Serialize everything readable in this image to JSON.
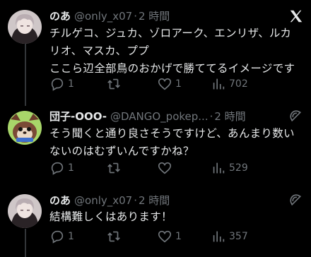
{
  "tweets": [
    {
      "name": "のあ",
      "handle": "@only_x07",
      "sep": "·",
      "time": "2 時間",
      "lines": [
        "チルゲコ、ジュカ、ゾロアーク、エンリザ、ルカ",
        "リオ、マスカ、ププ",
        "ここら辺全部鳥のおかげで勝ててるイメージです"
      ],
      "replies": "1",
      "retweets": "",
      "likes": "1",
      "views": "702",
      "top_icon": "x-logo-icon"
    },
    {
      "name": "団子-OOO-",
      "handle": "@DANGO_pokep...",
      "sep": "·",
      "time": "2 時間",
      "lines": [
        "そう聞くと通り良さそうですけど、あんまり数い",
        "ないのはむずいんですかね？"
      ],
      "replies": "1",
      "retweets": "",
      "likes": "",
      "views": "529",
      "top_icon": "grok-icon"
    },
    {
      "name": "のあ",
      "handle": "@only_x07",
      "sep": "·",
      "time": "2 時間",
      "lines": [
        "結構難しくはあります！"
      ],
      "replies": "1",
      "retweets": "",
      "likes": "1",
      "views": "357",
      "top_icon": "grok-icon"
    }
  ],
  "colors": {
    "background": "#000000",
    "text": "#e7e9ea",
    "secondary": "#71767b",
    "thread_line": "#333639"
  }
}
